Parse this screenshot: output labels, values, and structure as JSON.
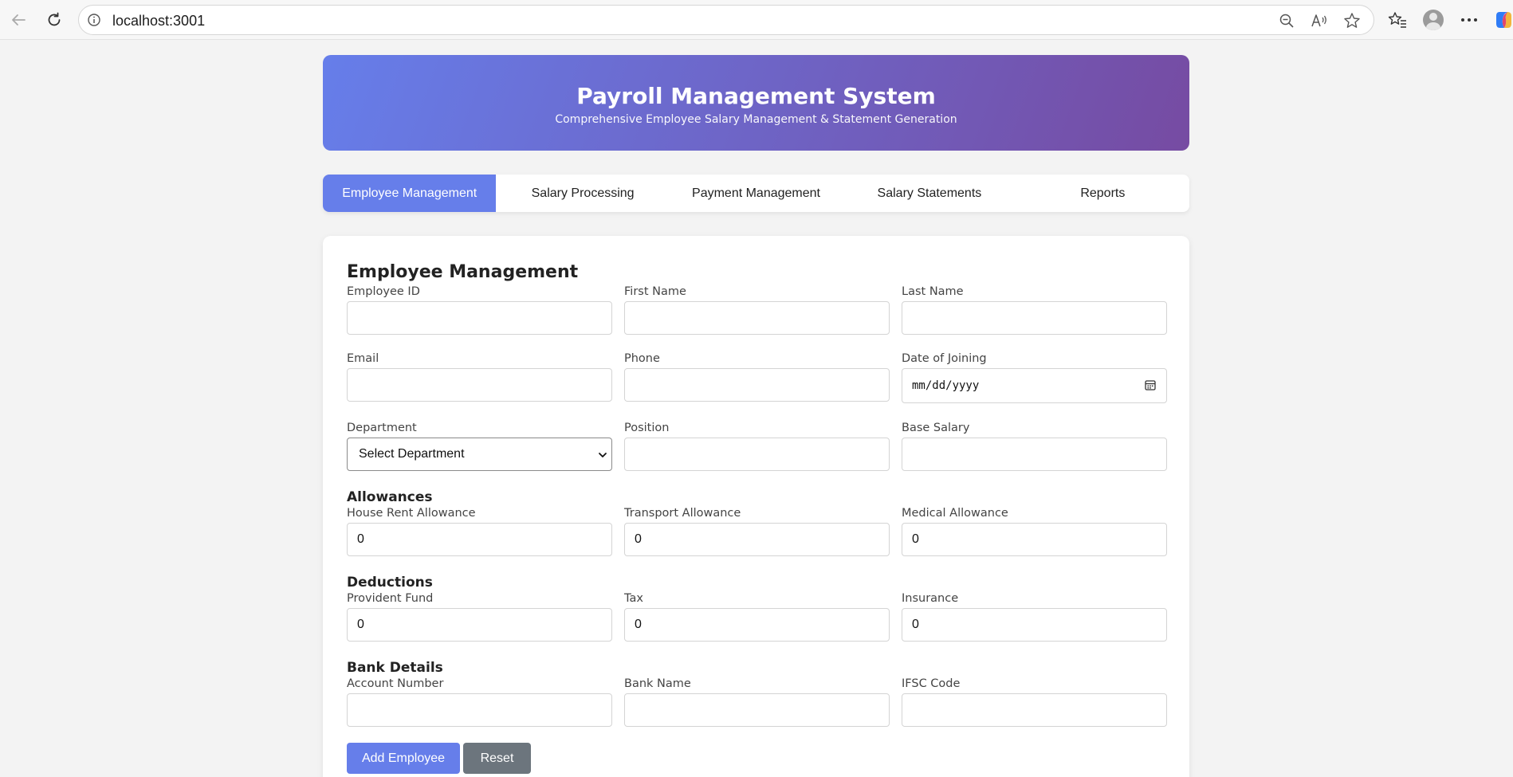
{
  "browser": {
    "url": "localhost:3001"
  },
  "header": {
    "title": "Payroll Management System",
    "subtitle": "Comprehensive Employee Salary Management & Statement Generation"
  },
  "tabs": [
    {
      "label": "Employee Management",
      "active": true
    },
    {
      "label": "Salary Processing",
      "active": false
    },
    {
      "label": "Payment Management",
      "active": false
    },
    {
      "label": "Salary Statements",
      "active": false
    },
    {
      "label": "Reports",
      "active": false
    }
  ],
  "form": {
    "title": "Employee Management",
    "employee_id": {
      "label": "Employee ID",
      "value": ""
    },
    "first_name": {
      "label": "First Name",
      "value": ""
    },
    "last_name": {
      "label": "Last Name",
      "value": ""
    },
    "email": {
      "label": "Email",
      "value": ""
    },
    "phone": {
      "label": "Phone",
      "value": ""
    },
    "date_of_joining": {
      "label": "Date of Joining",
      "value": "mm/dd/yyyy"
    },
    "department": {
      "label": "Department",
      "value": "Select Department"
    },
    "position": {
      "label": "Position",
      "value": ""
    },
    "base_salary": {
      "label": "Base Salary",
      "value": ""
    },
    "allowances": {
      "title": "Allowances",
      "hra": {
        "label": "House Rent Allowance",
        "value": "0"
      },
      "transport": {
        "label": "Transport Allowance",
        "value": "0"
      },
      "medical": {
        "label": "Medical Allowance",
        "value": "0"
      }
    },
    "deductions": {
      "title": "Deductions",
      "pf": {
        "label": "Provident Fund",
        "value": "0"
      },
      "tax": {
        "label": "Tax",
        "value": "0"
      },
      "insurance": {
        "label": "Insurance",
        "value": "0"
      }
    },
    "bank": {
      "title": "Bank Details",
      "account": {
        "label": "Account Number",
        "value": ""
      },
      "bank_name": {
        "label": "Bank Name",
        "value": ""
      },
      "ifsc": {
        "label": "IFSC Code",
        "value": ""
      }
    },
    "buttons": {
      "add": "Add Employee",
      "reset": "Reset"
    }
  },
  "colors": {
    "accent": "#667eea",
    "gradient_end": "#764ba2",
    "secondary": "#6c757d"
  }
}
